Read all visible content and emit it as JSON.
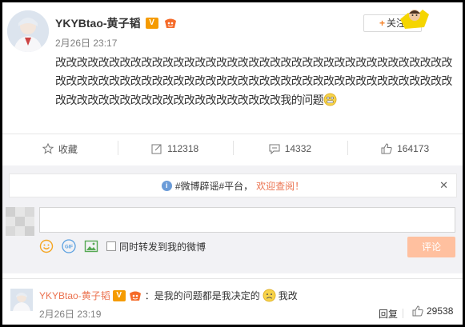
{
  "post": {
    "author": "YKYBtao-黄子韬",
    "verified_badge": "V",
    "meta": "2月26日 23:17",
    "text": "改改改改改改改改改改改改改改改改改改改改改改改改改改改改改改改改改改改改改改改改改改改改改改改改改改改改改改改改改改改改改改改改改改改改改改改改改改改改改改改改改改改改改改改改改改改改改改改我的问题",
    "follow_label": "关注"
  },
  "actions": {
    "favorite_label": "收藏",
    "repost_count": "112318",
    "comment_count": "14332",
    "like_count": "164173"
  },
  "comment_box": {
    "notice_prefix": "#微博辟谣#平台，",
    "notice_link": "欢迎查阅！",
    "input_value": "",
    "repost_label": "同时转发到我的微博",
    "submit_label": "评论"
  },
  "top_comment": {
    "author": "YKYBtao-黄子韬",
    "text_before": "：是我的问题都是我决定的",
    "text_after": "我改",
    "time": "2月26日 23:19",
    "reply_label": "回复",
    "like_count": "29538"
  },
  "colors": {
    "accent": "#eb7350",
    "verified": "#f59b00",
    "submit_disabled": "#ffc09f",
    "comment_bg": "#f2f2f5"
  },
  "icons": [
    "star-icon",
    "repost-icon",
    "comment-icon",
    "thumbs-up-icon",
    "info-icon",
    "close-icon",
    "smile-icon",
    "gif-icon",
    "image-icon"
  ]
}
